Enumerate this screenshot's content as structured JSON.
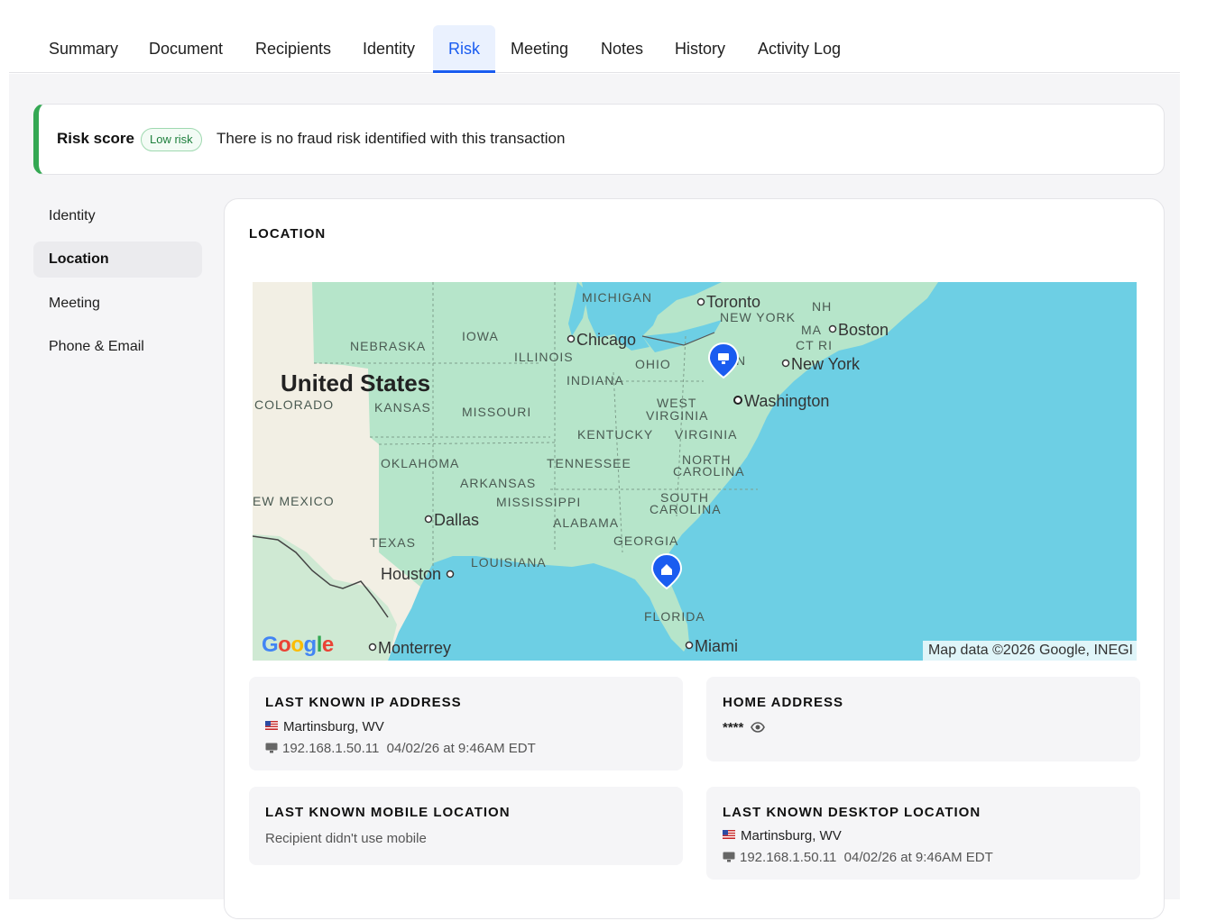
{
  "tabs": [
    {
      "label": "Summary"
    },
    {
      "label": "Document"
    },
    {
      "label": "Recipients"
    },
    {
      "label": "Identity"
    },
    {
      "label": "Risk"
    },
    {
      "label": "Meeting"
    },
    {
      "label": "Notes"
    },
    {
      "label": "History"
    },
    {
      "label": "Activity Log"
    }
  ],
  "active_tab": "Risk",
  "risk": {
    "title": "Risk score",
    "badge": "Low risk",
    "message": "There is no fraud risk identified with this transaction"
  },
  "sidebar": {
    "items": [
      {
        "label": "Identity"
      },
      {
        "label": "Location"
      },
      {
        "label": "Meeting"
      },
      {
        "label": "Phone & Email"
      }
    ],
    "active": "Location"
  },
  "location": {
    "title": "LOCATION",
    "map": {
      "country_label": "United States",
      "cities": [
        "Toronto",
        "Chicago",
        "Boston",
        "New York",
        "Washington",
        "Dallas",
        "Houston",
        "Miami",
        "Monterrey"
      ],
      "states": [
        "MICHIGAN",
        "NEW YORK",
        "NH",
        "MA",
        "CT",
        "RI",
        "IOWA",
        "NEBRASKA",
        "ILLINOIS",
        "OHIO",
        "INDIANA",
        "COLORADO",
        "KANSAS",
        "MISSOURI",
        "WEST",
        "VIRGINIA",
        "KENTUCKY",
        "VIRGINIA",
        "OKLAHOMA",
        "TENNESSEE",
        "NORTH",
        "CAROLINA",
        "ARKANSAS",
        "MISSISSIPPI",
        "SOUTH",
        "CAROLINA",
        "EW MEXICO",
        "ALABAMA",
        "GEORGIA",
        "TEXAS",
        "LOUISIANA",
        "FLORIDA",
        "N"
      ],
      "credit": "Map data ©2026 Google, INEGI",
      "logo": "Google",
      "markers": [
        "desktop-pin-icon",
        "home-pin-icon"
      ],
      "colors": {
        "water": "#6dcfe4",
        "land": "#b6e5ca",
        "land_dry": "#f2efe4",
        "marker": "#1a5cf0"
      }
    },
    "ip": {
      "title": "LAST KNOWN IP ADDRESS",
      "place": "Martinsburg, WV",
      "ip": "192.168.1.50.11",
      "time": "04/02/26 at 9:46AM EDT"
    },
    "home": {
      "title": "HOME ADDRESS",
      "masked": "****"
    },
    "mobile": {
      "title": "LAST KNOWN MOBILE LOCATION",
      "status": "Recipient didn't use mobile"
    },
    "desktop": {
      "title": "LAST KNOWN DESKTOP LOCATION",
      "place": "Martinsburg, WV",
      "ip": "192.168.1.50.11",
      "time": "04/02/26 at 9:46AM EDT"
    }
  }
}
